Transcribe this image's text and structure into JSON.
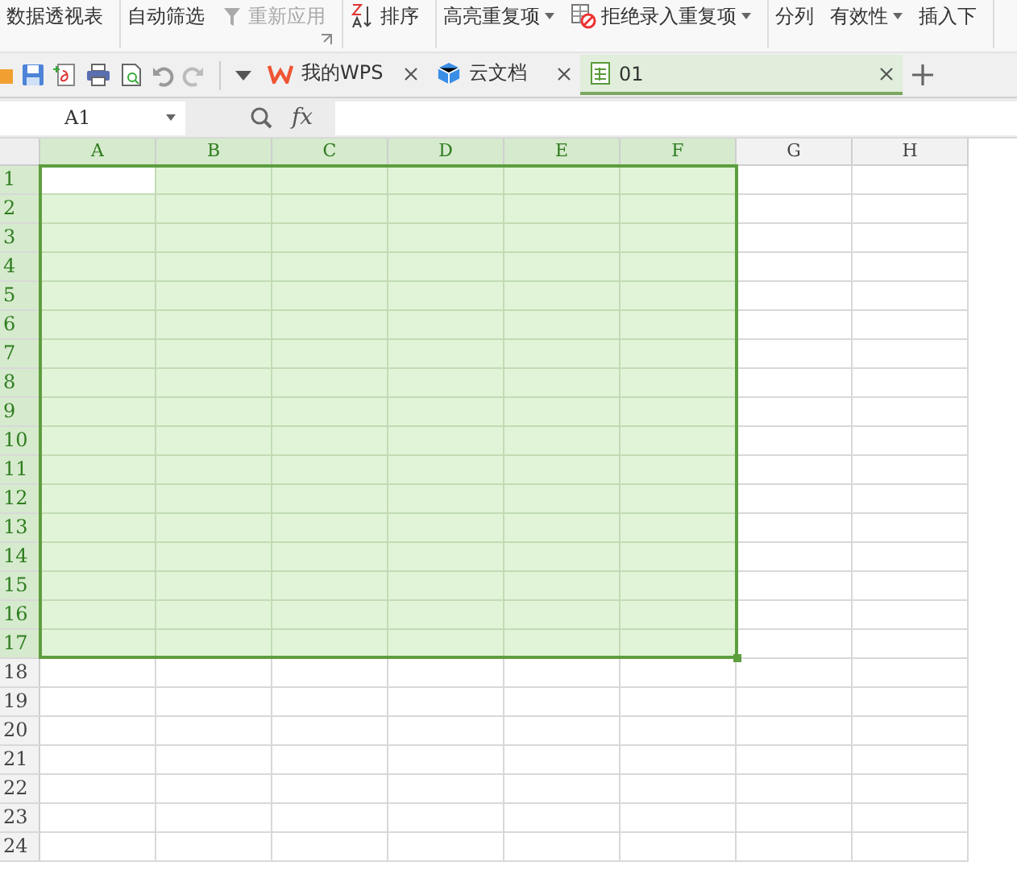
{
  "ribbon": {
    "groups": [
      [
        {
          "label": "数据透视表",
          "kind": "plain",
          "dropdown": false,
          "disabled": false
        }
      ],
      [
        {
          "label": "自动筛选",
          "kind": "plain",
          "dropdown": false,
          "disabled": false
        },
        {
          "label": "重新应用",
          "kind": "funnel",
          "dropdown": false,
          "disabled": true
        }
      ],
      [
        {
          "label": "排序",
          "kind": "sort",
          "dropdown": false,
          "disabled": false
        }
      ],
      [
        {
          "label": "高亮重复项",
          "kind": "plain",
          "dropdown": true,
          "disabled": false
        },
        {
          "label": "拒绝录入重复项",
          "kind": "forbid",
          "dropdown": true,
          "disabled": false
        }
      ],
      [
        {
          "label": "分列",
          "kind": "plain",
          "dropdown": false,
          "disabled": false
        },
        {
          "label": "有效性",
          "kind": "plain",
          "dropdown": true,
          "disabled": false
        },
        {
          "label": "插入下",
          "kind": "plain",
          "dropdown": false,
          "disabled": false
        }
      ]
    ]
  },
  "tabs": [
    {
      "label": "我的WPS",
      "kind": "wps",
      "selected": false
    },
    {
      "label": "云文档",
      "kind": "cloud",
      "selected": false
    },
    {
      "label": "01",
      "kind": "sheet",
      "selected": true
    }
  ],
  "formula_bar": {
    "name_box": "A1",
    "fx": "fx"
  },
  "columns": [
    {
      "label": "A",
      "selected": true,
      "active": true
    },
    {
      "label": "B",
      "selected": true,
      "active": false
    },
    {
      "label": "C",
      "selected": true,
      "active": false
    },
    {
      "label": "D",
      "selected": true,
      "active": false
    },
    {
      "label": "E",
      "selected": true,
      "active": false
    },
    {
      "label": "F",
      "selected": true,
      "active": false
    },
    {
      "label": "G",
      "selected": false,
      "active": false
    },
    {
      "label": "H",
      "selected": false,
      "active": false
    }
  ],
  "rows": [
    {
      "label": "1",
      "selected": true,
      "active": true
    },
    {
      "label": "2",
      "selected": true,
      "active": false
    },
    {
      "label": "3",
      "selected": true,
      "active": false
    },
    {
      "label": "4",
      "selected": true,
      "active": false
    },
    {
      "label": "5",
      "selected": true,
      "active": false
    },
    {
      "label": "6",
      "selected": true,
      "active": false
    },
    {
      "label": "7",
      "selected": true,
      "active": false
    },
    {
      "label": "8",
      "selected": true,
      "active": false
    },
    {
      "label": "9",
      "selected": true,
      "active": false
    },
    {
      "label": "10",
      "selected": true,
      "active": false
    },
    {
      "label": "11",
      "selected": true,
      "active": false
    },
    {
      "label": "12",
      "selected": true,
      "active": false
    },
    {
      "label": "13",
      "selected": true,
      "active": false
    },
    {
      "label": "14",
      "selected": true,
      "active": false
    },
    {
      "label": "15",
      "selected": true,
      "active": false
    },
    {
      "label": "16",
      "selected": true,
      "active": false
    },
    {
      "label": "17",
      "selected": true,
      "active": false
    },
    {
      "label": "18",
      "selected": false,
      "active": false
    },
    {
      "label": "19",
      "selected": false,
      "active": false
    },
    {
      "label": "20",
      "selected": false,
      "active": false
    },
    {
      "label": "21",
      "selected": false,
      "active": false
    },
    {
      "label": "22",
      "selected": false,
      "active": false
    },
    {
      "label": "23",
      "selected": false,
      "active": false
    },
    {
      "label": "24",
      "selected": false,
      "active": false
    }
  ]
}
